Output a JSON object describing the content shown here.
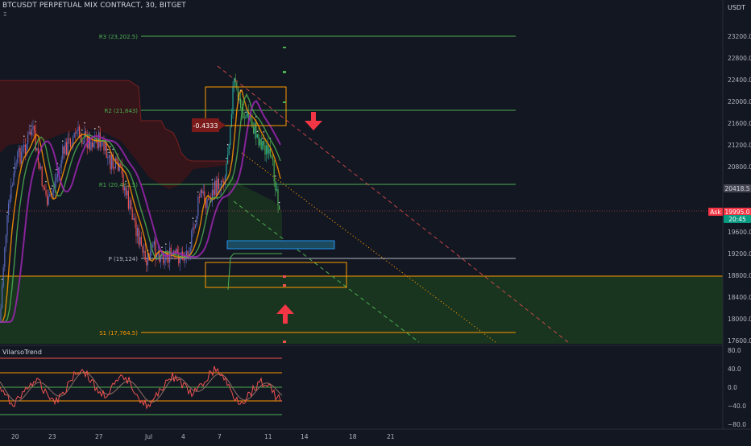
{
  "header": {
    "symbol_line": "BTCUSDT PERPETUAL MIX CONTRACT, 30, BITGET",
    "sub_icon": "Ξ"
  },
  "currency_label": "USDT",
  "indicator": {
    "name": "VilarsoTrend"
  },
  "price_axis": {
    "ticks": [
      "23200.0",
      "22800.0",
      "22400.0",
      "22000.0",
      "21600.0",
      "21200.0",
      "20800.0",
      "20400.0",
      "20000.0",
      "19600.0",
      "19200.0",
      "18800.0",
      "18400.0",
      "18000.0",
      "17600.0"
    ],
    "badges": [
      {
        "text": "20418.5",
        "color": "#434651",
        "text_color": "#d1d4dc"
      },
      {
        "text": "19995.0",
        "color": "#f23645",
        "text_color": "#ffffff"
      },
      {
        "text": "20:45",
        "color": "#089981",
        "text_color": "#ffffff"
      },
      {
        "text": "Ask",
        "color": "#f23645",
        "text_color": "#ffffff"
      }
    ]
  },
  "osc_axis": {
    "ticks": [
      "80.0",
      "40.0",
      "0.0",
      "−40.0",
      "−80.0"
    ]
  },
  "time_axis": {
    "ticks": [
      "20",
      "23",
      "27",
      "Jul",
      "4",
      "7",
      "11",
      "14",
      "18",
      "21"
    ]
  },
  "pivots": [
    {
      "label": "R3 (23,202.5)",
      "color": "#4caf50"
    },
    {
      "label": "R2 (21,843)",
      "color": "#4caf50"
    },
    {
      "label": "R1 (20,482.5)",
      "color": "#4caf50"
    },
    {
      "label": "P (19,124)",
      "color": "#b2b5be"
    },
    {
      "label": "S1 (17,764.5)",
      "color": "#ff9800"
    }
  ],
  "annotations": {
    "callout": "-0.4333"
  },
  "colors": {
    "background": "#131722",
    "up": "#26a69a",
    "down": "#ef5350",
    "grid": "#1e222d",
    "zone_green": "#1b3a1e",
    "zone_red": "#3a1518",
    "orange": "#ff9800",
    "arrow": "#f23645"
  },
  "icons": [
    "arrow-down-icon",
    "arrow-up-icon"
  ]
}
